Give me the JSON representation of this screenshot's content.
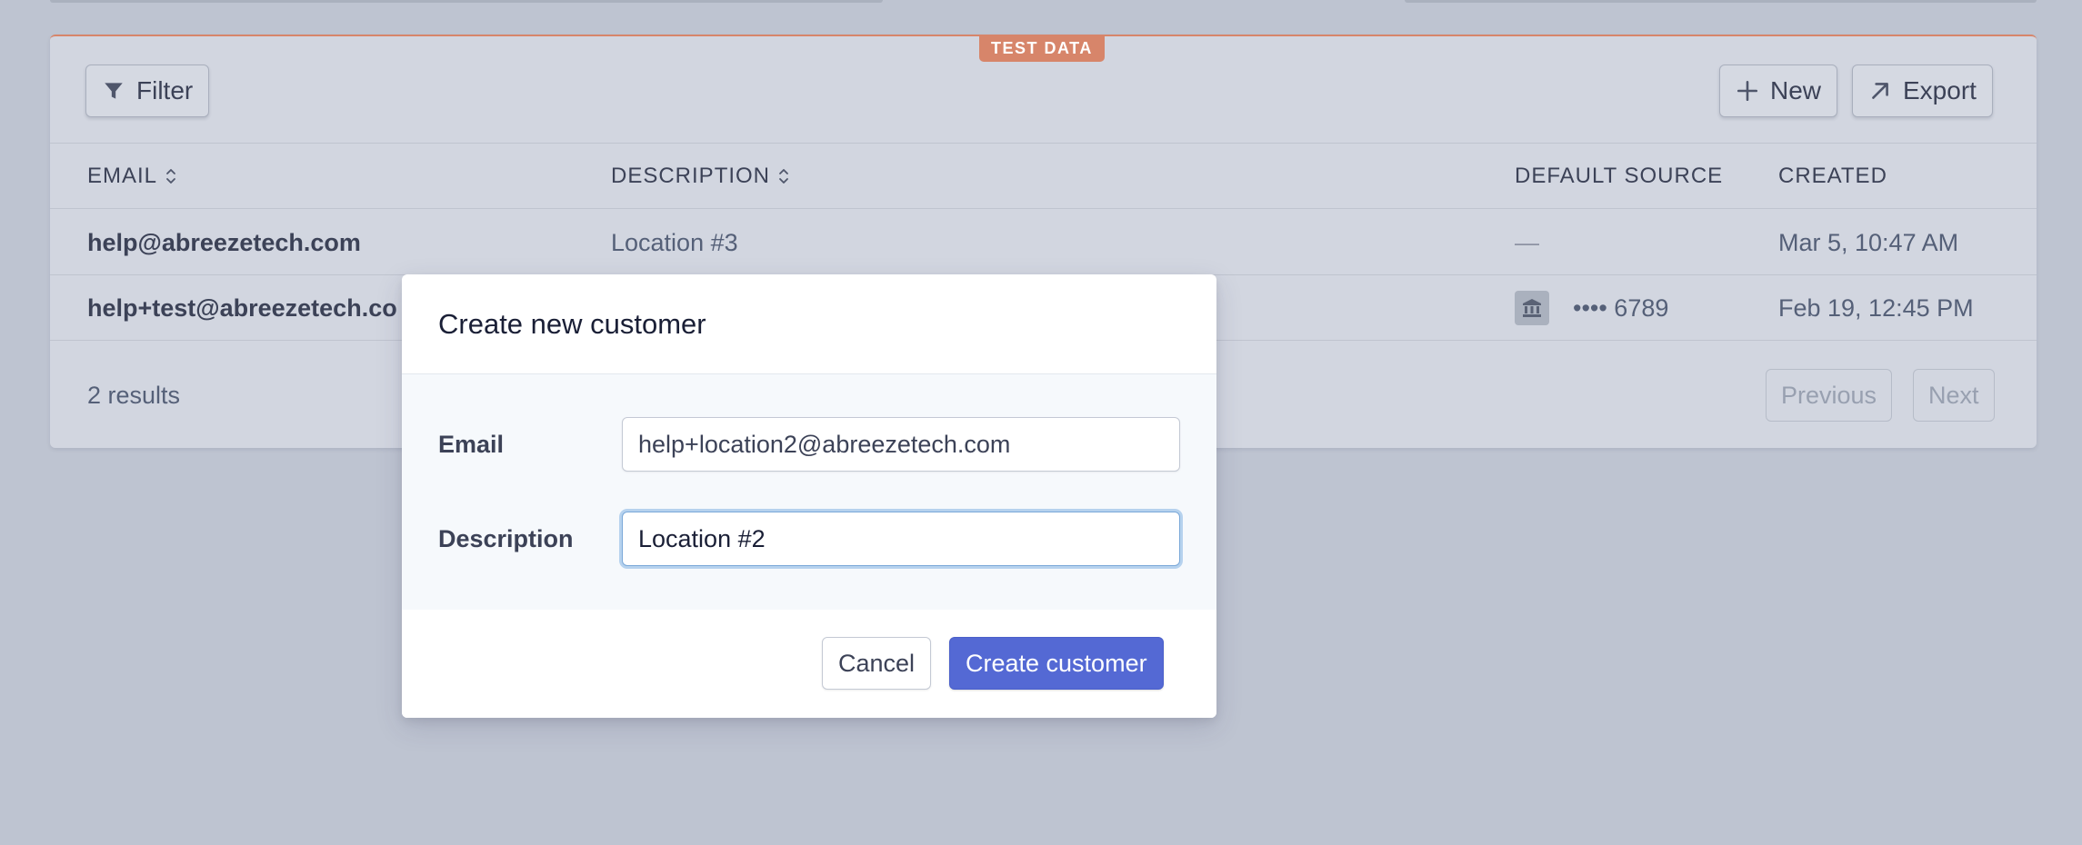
{
  "badge": "TEST DATA",
  "toolbar": {
    "filter_label": "Filter",
    "new_label": "New",
    "export_label": "Export"
  },
  "table": {
    "columns": [
      "EMAIL",
      "DESCRIPTION",
      "DEFAULT SOURCE",
      "CREATED"
    ],
    "rows": [
      {
        "email": "help@abreezetech.com",
        "description": "Location #3",
        "default_source": "—",
        "created": "Mar 5, 10:47 AM"
      },
      {
        "email": "help+test@abreezetech.co",
        "description": "",
        "default_source": "•••• 6789",
        "created": "Feb 19, 12:45 PM"
      }
    ]
  },
  "footer": {
    "results": "2 results",
    "previous_label": "Previous",
    "next_label": "Next"
  },
  "modal": {
    "title": "Create new customer",
    "email_label": "Email",
    "email_value": "help+location2@abreezetech.com",
    "description_label": "Description",
    "description_value": "Location #2",
    "cancel_label": "Cancel",
    "create_label": "Create customer"
  },
  "colors": {
    "accent": "#5469d4",
    "test_badge": "#d7856a",
    "overlay": "#bec4d1"
  },
  "icons": [
    "filter-icon",
    "plus-icon",
    "arrow-up-right-icon",
    "sort-icon",
    "bank-icon"
  ]
}
